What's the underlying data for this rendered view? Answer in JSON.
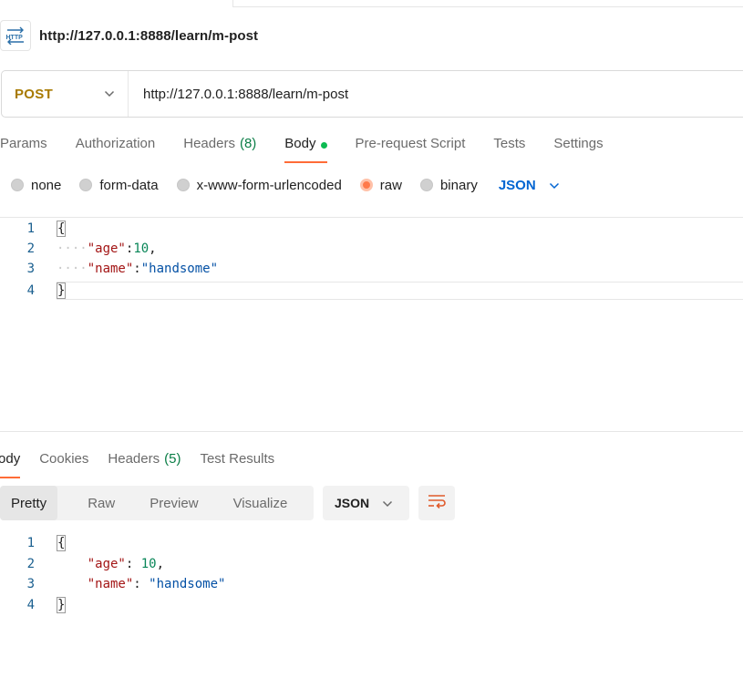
{
  "request": {
    "title": "http://127.0.0.1:8888/learn/m-post",
    "badge_icon": "http-icon",
    "method": "POST",
    "url": "http://127.0.0.1:8888/learn/m-post"
  },
  "request_tabs": [
    {
      "label": "Params"
    },
    {
      "label": "Authorization"
    },
    {
      "label": "Headers",
      "count": "(8)"
    },
    {
      "label": "Body",
      "active": true
    },
    {
      "label": "Pre-request Script"
    },
    {
      "label": "Tests"
    },
    {
      "label": "Settings"
    }
  ],
  "body_types": [
    {
      "label": "none",
      "selected": false
    },
    {
      "label": "form-data",
      "selected": false
    },
    {
      "label": "x-www-form-urlencoded",
      "selected": false
    },
    {
      "label": "raw",
      "selected": true
    },
    {
      "label": "binary",
      "selected": false
    }
  ],
  "body_language": "JSON",
  "request_body": {
    "line_numbers": [
      "1",
      "2",
      "3",
      "4"
    ],
    "open_brace": "{",
    "close_brace": "}",
    "indent": "····",
    "age_key": "\"age\"",
    "age_value": "10",
    "name_key": "\"name\"",
    "name_value": "\"handsome\""
  },
  "response_tabs": [
    {
      "label": "Body",
      "active": true
    },
    {
      "label": "Cookies"
    },
    {
      "label": "Headers",
      "count": "(5)"
    },
    {
      "label": "Test Results"
    }
  ],
  "response_views": [
    {
      "label": "Pretty",
      "active": true
    },
    {
      "label": "Raw"
    },
    {
      "label": "Preview"
    },
    {
      "label": "Visualize"
    }
  ],
  "response_format": "JSON",
  "response_body": {
    "line_numbers": [
      "1",
      "2",
      "3",
      "4"
    ],
    "open_brace": "{",
    "close_brace": "}",
    "indent": "    ",
    "age_key": "\"age\"",
    "age_value": "10",
    "name_key": "\"name\"",
    "name_value": "\"handsome\""
  },
  "colors": {
    "accent": "#ff6c37",
    "method": "#a87a00",
    "link_blue": "#0265d2",
    "count_green": "#0a7d46"
  }
}
